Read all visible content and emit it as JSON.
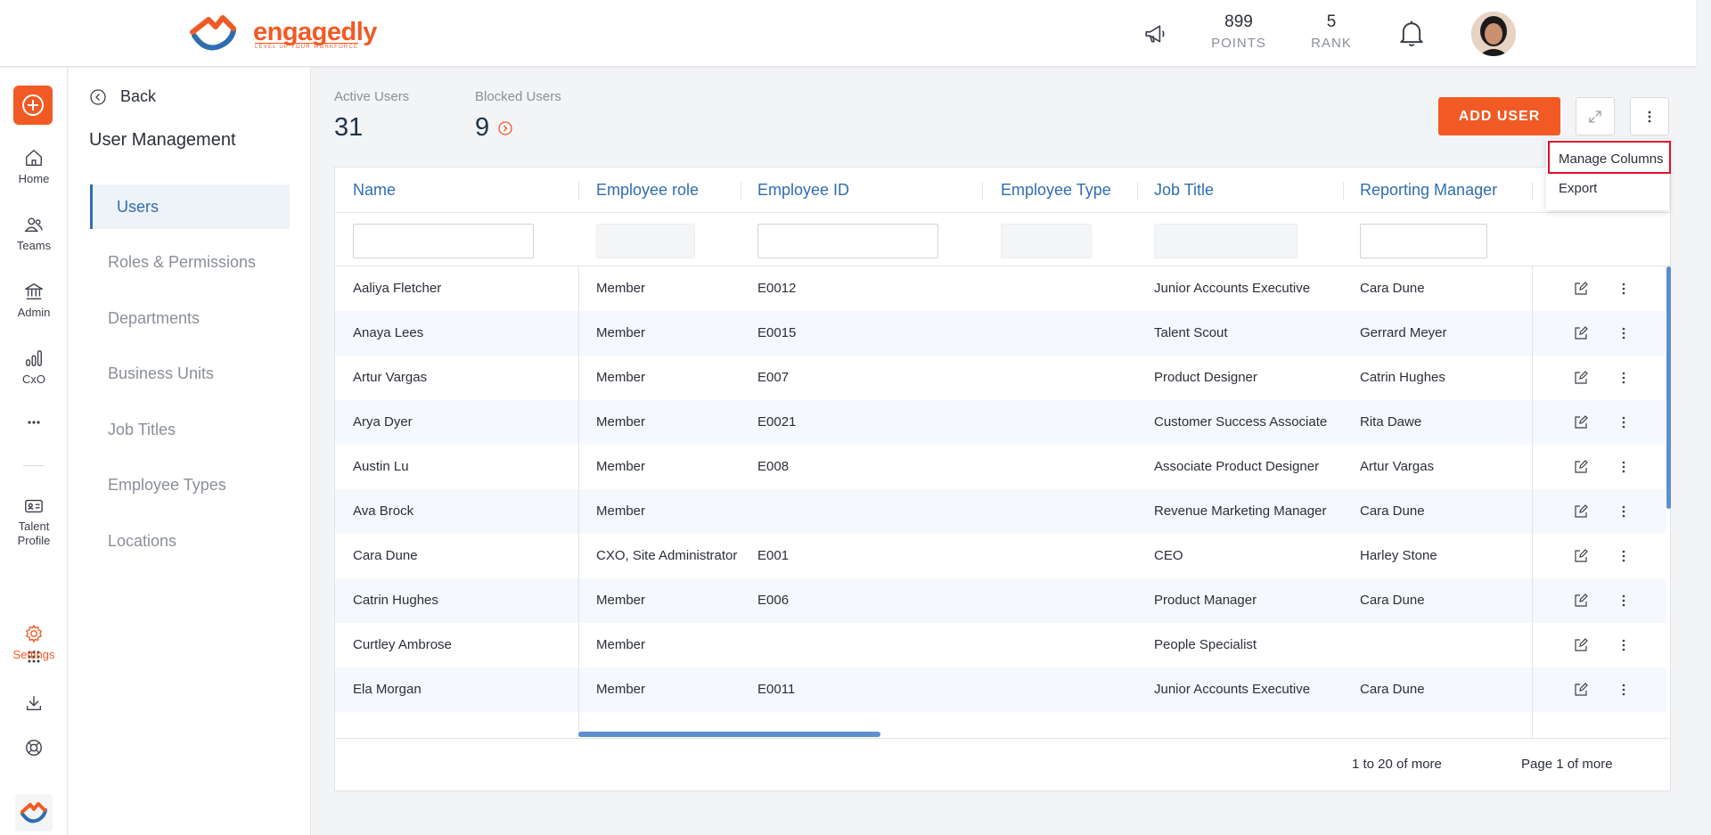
{
  "brand": {
    "name": "engagedly",
    "tagline": "LEVEL UP YOUR WORKFORCE",
    "accent": "#f15a24",
    "link_blue": "#2f6db0"
  },
  "topbar": {
    "announce_icon": "megaphone-icon",
    "points_value": "899",
    "points_label": "POINTS",
    "rank_value": "5",
    "rank_label": "RANK",
    "notification_icon": "bell-icon"
  },
  "rail": {
    "add_icon": "plus-circle-icon",
    "items": [
      {
        "label": "Home",
        "icon": "home-icon"
      },
      {
        "label": "Teams",
        "icon": "teams-icon"
      },
      {
        "label": "Admin",
        "icon": "bank-icon"
      },
      {
        "label": "CxO",
        "icon": "bar-chart-icon"
      },
      {
        "label": "",
        "icon": "more-icon"
      },
      {
        "label": "Talent Profile",
        "icon": "id-card-icon"
      },
      {
        "label": "",
        "icon": "apps-grid-icon"
      },
      {
        "label": "Settings",
        "icon": "gear-icon"
      },
      {
        "label": "",
        "icon": "download-icon"
      },
      {
        "label": "",
        "icon": "help-icon"
      }
    ]
  },
  "subnav": {
    "back_label": "Back",
    "title": "User Management",
    "items": [
      "Users",
      "Roles & Permissions",
      "Departments",
      "Business Units",
      "Job Titles",
      "Employee Types",
      "Locations"
    ],
    "active": "Users"
  },
  "metrics": {
    "active_label": "Active Users",
    "active_value": "31",
    "blocked_label": "Blocked Users",
    "blocked_value": "9"
  },
  "actions": {
    "add_user_label": "ADD USER",
    "menu": {
      "manage_columns": "Manage Columns",
      "export": "Export"
    }
  },
  "table": {
    "columns": [
      "Name",
      "Employee role",
      "Employee ID",
      "Employee Type",
      "Job Title",
      "Reporting Manager"
    ],
    "rows": [
      {
        "name": "Aaliya Fletcher",
        "role": "Member",
        "id": "E0012",
        "type": "",
        "title": "Junior Accounts Executive",
        "manager": "Cara Dune"
      },
      {
        "name": "Anaya Lees",
        "role": "Member",
        "id": "E0015",
        "type": "",
        "title": "Talent Scout",
        "manager": "Gerrard Meyer"
      },
      {
        "name": "Artur Vargas",
        "role": "Member",
        "id": "E007",
        "type": "",
        "title": "Product Designer",
        "manager": "Catrin Hughes"
      },
      {
        "name": "Arya Dyer",
        "role": "Member",
        "id": "E0021",
        "type": "",
        "title": "Customer Success Associate",
        "manager": "Rita Dawe"
      },
      {
        "name": "Austin Lu",
        "role": "Member",
        "id": "E008",
        "type": "",
        "title": "Associate Product Designer",
        "manager": "Artur Vargas"
      },
      {
        "name": "Ava Brock",
        "role": "Member",
        "id": "",
        "type": "",
        "title": "Revenue Marketing Manager",
        "manager": "Cara Dune"
      },
      {
        "name": "Cara Dune",
        "role": "CXO, Site Administrator",
        "id": "E001",
        "type": "",
        "title": "CEO",
        "manager": "Harley Stone"
      },
      {
        "name": "Catrin Hughes",
        "role": "Member",
        "id": "E006",
        "type": "",
        "title": "Product Manager",
        "manager": "Cara Dune"
      },
      {
        "name": "Curtley Ambrose",
        "role": "Member",
        "id": "",
        "type": "",
        "title": "People Specialist",
        "manager": ""
      },
      {
        "name": "Ela Morgan",
        "role": "Member",
        "id": "E0011",
        "type": "",
        "title": "Junior Accounts Executive",
        "manager": "Cara Dune"
      }
    ],
    "footer": {
      "range": "1 to 20 of more",
      "page": "Page 1 of more"
    }
  }
}
